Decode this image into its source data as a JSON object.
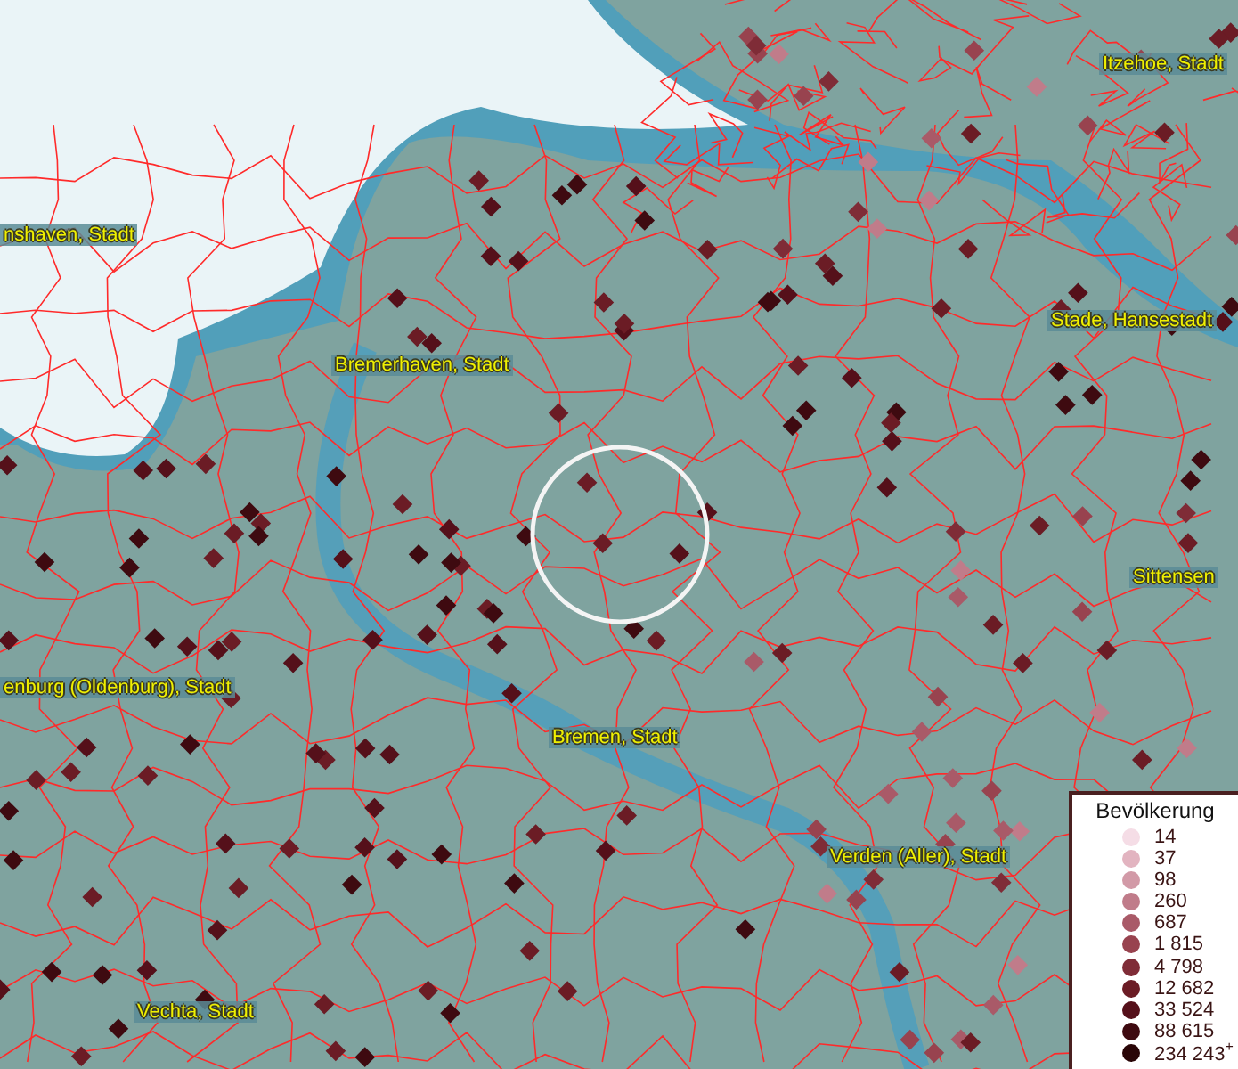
{
  "map": {
    "place_labels": [
      {
        "text": "Itzehoe, Stadt"
      },
      {
        "text": "Bremerhaven, Stadt"
      },
      {
        "text": "nshaven, Stadt"
      },
      {
        "text": "Stade, Hansestadt"
      },
      {
        "text": "Sittensen"
      },
      {
        "text": "enburg (Oldenburg), Stadt"
      },
      {
        "text": "Bremen, Stadt"
      },
      {
        "text": "Verden (Aller), Stadt"
      },
      {
        "text": "Vechta, Stadt"
      }
    ]
  },
  "legend": {
    "title": "Bevölkerung",
    "items": [
      {
        "label": "14",
        "color": "#f5dde6"
      },
      {
        "label": "37",
        "color": "#e2b4c0"
      },
      {
        "label": "98",
        "color": "#d29aa7"
      },
      {
        "label": "260",
        "color": "#c07c8a"
      },
      {
        "label": "687",
        "color": "#a95a68"
      },
      {
        "label": "1 815",
        "color": "#98434f"
      },
      {
        "label": "4 798",
        "color": "#7f2c37"
      },
      {
        "label": "12 682",
        "color": "#6b1c25"
      },
      {
        "label": "33 524",
        "color": "#55101a"
      },
      {
        "label": "88 615",
        "color": "#3e0a10"
      },
      {
        "label": "234 243$^{+}$",
        "color": "#290507"
      }
    ]
  }
}
